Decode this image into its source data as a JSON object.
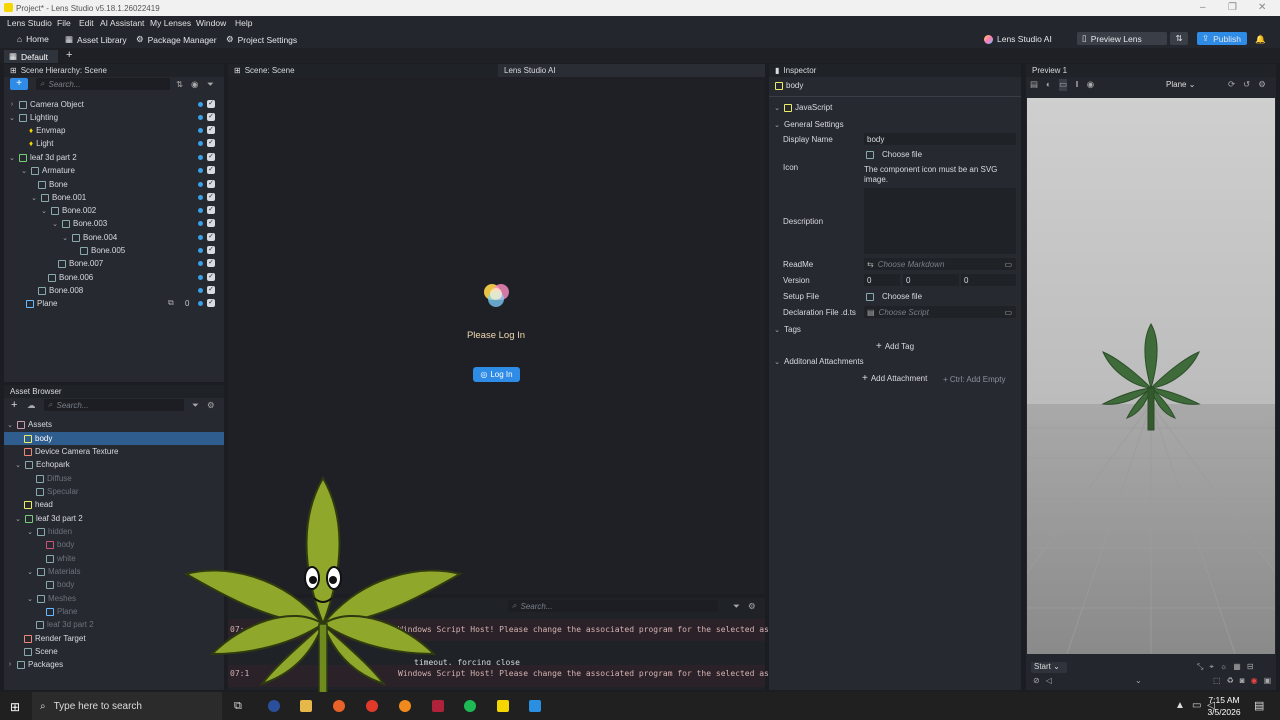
{
  "window": {
    "title": "Project* - Lens Studio v5.18.1.26022419"
  },
  "menu": [
    "Lens Studio",
    "File",
    "Edit",
    "AI Assistant",
    "My Lenses",
    "Window",
    "Help"
  ],
  "toolbar": {
    "home": "Home",
    "asset_library": "Asset Library",
    "package_manager": "Package Manager",
    "project_settings": "Project Settings",
    "lens_studio_ai": "Lens Studio AI",
    "preview_lens": "Preview Lens",
    "publish": "Publish"
  },
  "tabs": {
    "default": "Default"
  },
  "scene_hierarchy": {
    "title": "Scene Hierarchy: Scene",
    "search_placeholder": "Search...",
    "items": [
      {
        "label": "Camera Object"
      },
      {
        "label": "Lighting"
      },
      {
        "label": "Envmap"
      },
      {
        "label": "Light"
      },
      {
        "label": "leaf 3d part 2"
      },
      {
        "label": "Armature"
      },
      {
        "label": "Bone"
      },
      {
        "label": "Bone.001"
      },
      {
        "label": "Bone.002"
      },
      {
        "label": "Bone.003"
      },
      {
        "label": "Bone.004"
      },
      {
        "label": "Bone.005"
      },
      {
        "label": "Bone.007"
      },
      {
        "label": "Bone.006"
      },
      {
        "label": "Bone.008"
      },
      {
        "label": "Plane",
        "count": "0"
      }
    ]
  },
  "scene_view": {
    "title": "Scene: Scene",
    "ai_tab": "Lens Studio AI",
    "prompt": "Please Log In",
    "login_button": "Log In"
  },
  "asset_browser": {
    "title": "Asset Browser",
    "search_placeholder": "Search...",
    "items": [
      {
        "label": "Assets"
      },
      {
        "label": "body"
      },
      {
        "label": "Device Camera Texture"
      },
      {
        "label": "Echopark"
      },
      {
        "label": "Diffuse"
      },
      {
        "label": "Specular"
      },
      {
        "label": "head"
      },
      {
        "label": "leaf 3d part 2"
      },
      {
        "label": "hidden"
      },
      {
        "label": "body"
      },
      {
        "label": "white"
      },
      {
        "label": "Materials"
      },
      {
        "label": "body"
      },
      {
        "label": "Meshes"
      },
      {
        "label": "Plane"
      },
      {
        "label": "leaf 3d part 2"
      },
      {
        "label": "Render Target"
      },
      {
        "label": "Scene"
      },
      {
        "label": "Packages"
      }
    ]
  },
  "console": {
    "search_placeholder": "Search...",
    "lines": [
      {
        "time": "07:",
        "text": "Windows Script Host! Please change the associated program for the selected as"
      },
      {
        "time": "",
        "text": "timeout, forcing close"
      },
      {
        "time": "07:1",
        "text": "Windows Script Host! Please change the associated program for the selected as"
      }
    ]
  },
  "inspector": {
    "title": "Inspector",
    "object": "body",
    "component": "JavaScript",
    "general_settings": "General Settings",
    "display_name_label": "Display Name",
    "display_name_value": "body",
    "choose_file": "Choose file",
    "icon_label": "Icon",
    "icon_hint": "The component icon must be an SVG image.",
    "description_label": "Description",
    "readme_label": "ReadMe",
    "readme_placeholder": "Choose Markdown",
    "version_label": "Version",
    "version": [
      "0",
      "0",
      "0"
    ],
    "setup_file_label": "Setup File",
    "setup_choose": "Choose file",
    "declaration_label": "Declaration File .d.ts",
    "declaration_placeholder": "Choose Script",
    "tags": "Tags",
    "add_tag": "Add Tag",
    "attachments": "Additonal Attachments",
    "add_attachment": "Add Attachment",
    "add_empty_hint": "+ Ctrl: Add Empty"
  },
  "preview": {
    "title": "Preview 1",
    "device": "Plane",
    "start": "Start"
  },
  "taskbar": {
    "search_placeholder": "Type here to search",
    "time": "7:15 AM",
    "date": "3/5/2026"
  },
  "colors": {
    "accent": "#2e8be6",
    "selection": "#2e5d8e",
    "leaf": "#3f6b3a"
  }
}
